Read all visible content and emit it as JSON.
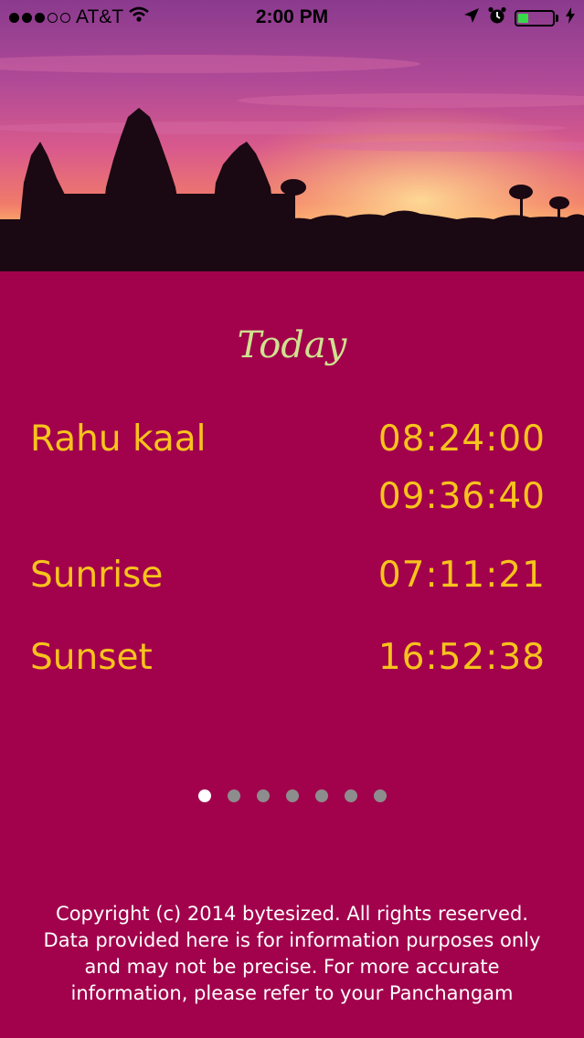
{
  "status_bar": {
    "carrier": "AT&T",
    "time": "2:00 PM",
    "signal_dots_filled": 3,
    "signal_dots_total": 5,
    "battery_level": 0.3,
    "icons": [
      "wifi-icon",
      "location-arrow-icon",
      "alarm-clock-icon",
      "battery-icon",
      "charging-bolt-icon"
    ]
  },
  "header_image": {
    "subject": "temple silhouette at sunset"
  },
  "page_title": "Today",
  "rows": [
    {
      "label": "Rahu kaal",
      "values": [
        "08:24:00",
        "09:36:40"
      ]
    },
    {
      "label": "Sunrise",
      "values": [
        "07:11:21"
      ]
    },
    {
      "label": "Sunset",
      "values": [
        "16:52:38"
      ]
    }
  ],
  "pager": {
    "count": 7,
    "active_index": 0
  },
  "footer": {
    "lines": [
      "Copyright (c) 2014 bytesized. All rights reserved.",
      "Data provided here is for information purposes only",
      "and may not be precise.  For more accurate",
      "information, please refer to your Panchangam"
    ]
  },
  "colors": {
    "background": "#a2024c",
    "title": "#cfe28f",
    "text_accent": "#f7c31c",
    "footer_text": "#ffffff",
    "pager_active": "#ffffff",
    "pager_inactive": "#8d8d8d"
  }
}
